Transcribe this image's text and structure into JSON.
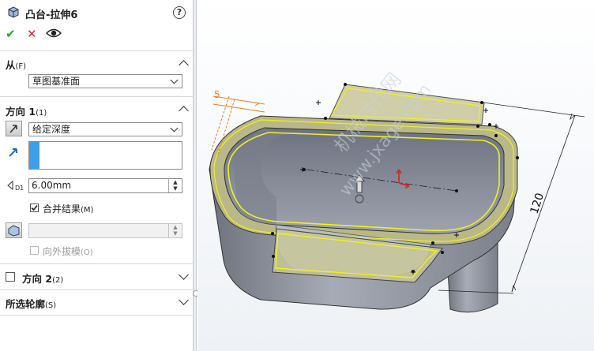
{
  "panel": {
    "title": "凸台-拉伸6",
    "ok_symbol": "✔",
    "cancel_symbol": "✕",
    "from": {
      "label": "从",
      "hotkey": "(F)",
      "value": "草图基准面"
    },
    "direction1": {
      "label": "方向 1",
      "hotkey": "(1)",
      "end_condition": "给定深度",
      "depth": "6.00mm",
      "merge_label": "合并结果",
      "merge_hotkey": "(M)",
      "merge_checked": true,
      "draft_label": "向外拔模",
      "draft_hotkey": "(O)"
    },
    "direction2": {
      "label": "方向 2",
      "hotkey": "(2)"
    },
    "selected_contours": {
      "label": "所选轮廓",
      "hotkey": "(S)"
    }
  },
  "viewport": {
    "dim_depth": "5",
    "dim_length": "120",
    "watermark_1": "机械时代网",
    "watermark_2": "www.jxage.com"
  },
  "colors": {
    "accent_green": "#22a03a",
    "accent_red": "#d42a2a",
    "highlight_yellow": "#f0f020",
    "dim_orange": "#e08020",
    "part_gray": "#8d919c"
  }
}
